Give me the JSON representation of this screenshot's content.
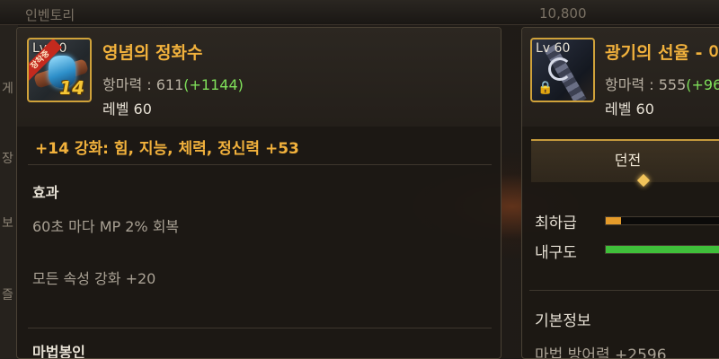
{
  "background": {
    "top_left_text": "인벤토리",
    "gold_amount": "10,800",
    "left_tab_fragments": [
      "게",
      "장",
      "보",
      "즐"
    ]
  },
  "tooltip": {
    "icon": {
      "level_label": "Lv 60",
      "ribbon_text": "장착중",
      "enhance_level": "14",
      "icon_name": "gem-bracelet-icon"
    },
    "item_name": "영념의 정화수",
    "stat_label": "항마력 : 611",
    "stat_bonus": "(+1144)",
    "level_text": "레벨 60",
    "enhance_line": "+14 강화: 힘, 지능, 체력, 정신력 +53",
    "effect_title": "효과",
    "effects": [
      "60초 마다 MP 2% 회복",
      "모든 속성 강화 +20"
    ],
    "magic_seal_title": "마법봉인"
  },
  "compare": {
    "icon": {
      "level_label": "Lv 60",
      "icon_name": "spiral-spear-icon",
      "lock_icon": "lock-icon"
    },
    "item_name": "광기의 선율 - 이",
    "stat_label": "항마력 : 555",
    "stat_bonus": "(+96",
    "level_text": "레벨 60",
    "dungeon_tab": "던전",
    "grade_label": "최하급",
    "grade_value": 0.12,
    "durability_label": "내구도",
    "durability_value": 1.0,
    "basic_info_title": "기본정보",
    "basic_stat": "마법 방어력 +2596"
  },
  "colors": {
    "accent_gold": "#f1b13c",
    "bonus_green": "#7fe05a",
    "grade_orange": "#e59b2a",
    "durability_green": "#3fbf3a"
  }
}
